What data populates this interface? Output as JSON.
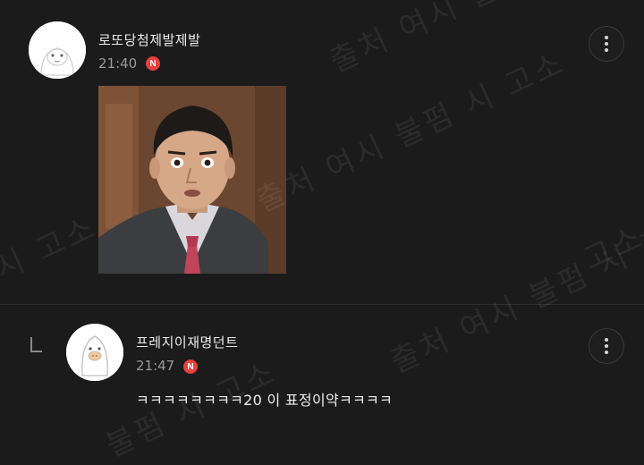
{
  "comments": [
    {
      "author": "로또당첨제발제발",
      "time": "21:40",
      "badge": "N",
      "attachment_icon": "reaction-photo"
    },
    {
      "author": "프레지이재명던트",
      "time": "21:47",
      "badge": "N",
      "text": "ㅋㅋㅋㅋㅋㅋㅋㅋ20 이 표정이약ㅋㅋㅋㅋ"
    }
  ],
  "watermark": {
    "a": "출처 여시 불펌 시 고소",
    "b": "출처 여시 불펌 시 고소",
    "c": "시 고소",
    "d": "출처 여시 불펌 시 고소",
    "e": "불펌 시 고소",
    "f": "출처 여시 불",
    "g": "고소"
  },
  "icons": {
    "more": "more-vertical-icon",
    "reply": "reply-arrow-icon"
  },
  "colors": {
    "background": "#1b1b1b",
    "badge": "#e8403a",
    "text": "#e8e8e8",
    "time": "#9a9a9a"
  }
}
